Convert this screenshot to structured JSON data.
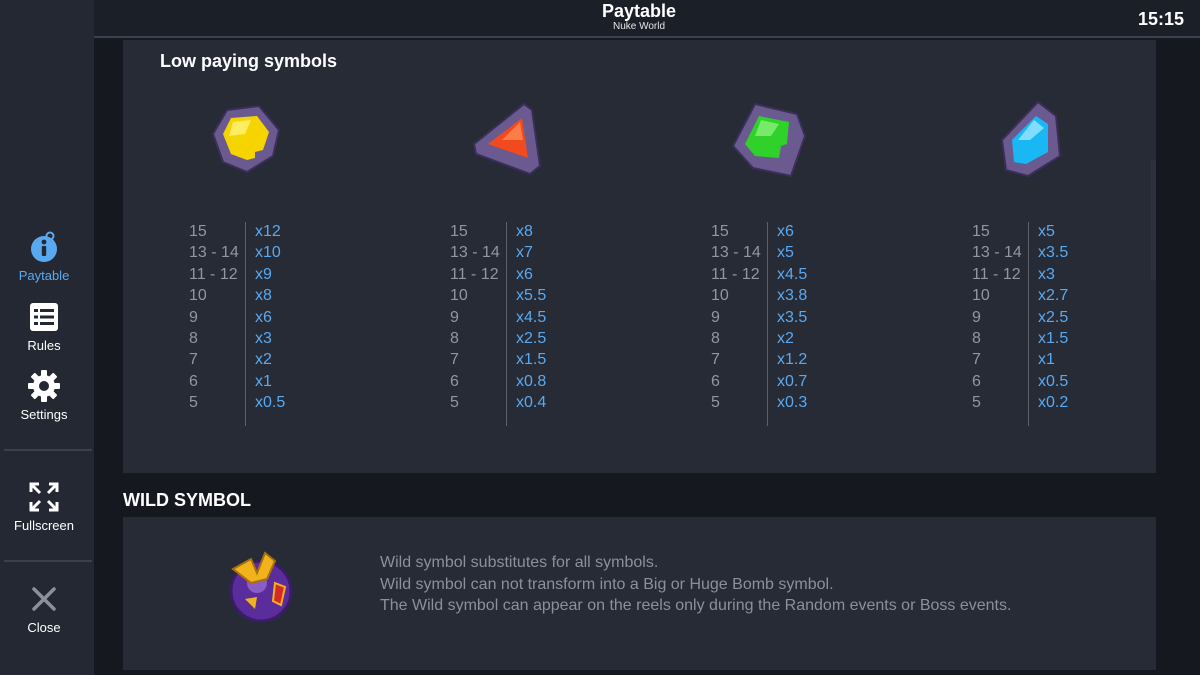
{
  "header": {
    "title": "Paytable",
    "subtitle": "Nuke World",
    "clock": "15:15"
  },
  "sidebar": {
    "items": [
      {
        "label": "Paytable",
        "icon": "info-bubble-icon",
        "active": true
      },
      {
        "label": "Rules",
        "icon": "list-icon",
        "active": false
      },
      {
        "label": "Settings",
        "icon": "gear-icon",
        "active": false
      },
      {
        "label": "Fullscreen",
        "icon": "fullscreen-icon",
        "active": false
      },
      {
        "label": "Close",
        "icon": "close-icon",
        "active": false
      }
    ]
  },
  "low_paying": {
    "title": "Low paying symbols",
    "symbols": [
      {
        "icon": "yellow-gem-icon",
        "color": "#f5d400",
        "rows": [
          [
            "15",
            "x12"
          ],
          [
            "13 - 14",
            "x10"
          ],
          [
            "11 - 12",
            "x9"
          ],
          [
            "10",
            "x8"
          ],
          [
            "9",
            "x6"
          ],
          [
            "8",
            "x3"
          ],
          [
            "7",
            "x2"
          ],
          [
            "6",
            "x1"
          ],
          [
            "5",
            "x0.5"
          ]
        ]
      },
      {
        "icon": "red-gem-icon",
        "color": "#f04a1e",
        "rows": [
          [
            "15",
            "x8"
          ],
          [
            "13 - 14",
            "x7"
          ],
          [
            "11 - 12",
            "x6"
          ],
          [
            "10",
            "x5.5"
          ],
          [
            "9",
            "x4.5"
          ],
          [
            "8",
            "x2.5"
          ],
          [
            "7",
            "x1.5"
          ],
          [
            "6",
            "x0.8"
          ],
          [
            "5",
            "x0.4"
          ]
        ]
      },
      {
        "icon": "green-gem-icon",
        "color": "#2fd12a",
        "rows": [
          [
            "15",
            "x6"
          ],
          [
            "13 - 14",
            "x5"
          ],
          [
            "11 - 12",
            "x4.5"
          ],
          [
            "10",
            "x3.8"
          ],
          [
            "9",
            "x3.5"
          ],
          [
            "8",
            "x2"
          ],
          [
            "7",
            "x1.2"
          ],
          [
            "6",
            "x0.7"
          ],
          [
            "5",
            "x0.3"
          ]
        ]
      },
      {
        "icon": "blue-gem-icon",
        "color": "#19b8f5",
        "rows": [
          [
            "15",
            "x5"
          ],
          [
            "13 - 14",
            "x3.5"
          ],
          [
            "11 - 12",
            "x3"
          ],
          [
            "10",
            "x2.7"
          ],
          [
            "9",
            "x2.5"
          ],
          [
            "8",
            "x1.5"
          ],
          [
            "7",
            "x1"
          ],
          [
            "6",
            "x0.5"
          ],
          [
            "5",
            "x0.2"
          ]
        ]
      }
    ]
  },
  "wild": {
    "title": "WILD SYMBOL",
    "icon": "wild-symbol-icon",
    "lines": [
      "Wild symbol substitutes for all symbols.",
      "Wild symbol can not transform into a Big or Huge Bomb symbol.",
      "The Wild symbol can appear on the reels only during the Random events or Boss events."
    ]
  },
  "colors": {
    "accent": "#5aa9f0",
    "panel": "#262b36",
    "sidebar": "#232833"
  }
}
